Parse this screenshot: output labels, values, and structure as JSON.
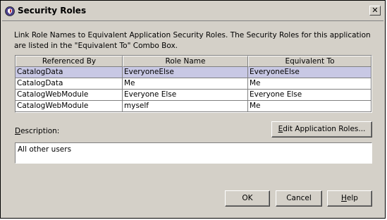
{
  "window": {
    "title": "Security Roles",
    "close_glyph": "✕"
  },
  "intro": {
    "line1": "Link Role Names to Equivalent Application Security Roles.  The Security Roles for this application",
    "line2": "are listed in the \"Equivalent To\" Combo Box."
  },
  "table": {
    "headers": [
      "Referenced By",
      "Role Name",
      "Equivalent To"
    ],
    "rows": [
      [
        "CatalogData",
        "EveryoneElse",
        "EveryoneElse"
      ],
      [
        "CatalogData",
        "Me",
        "Me"
      ],
      [
        "CatalogWebModule",
        "Everyone Else",
        "Everyone Else"
      ],
      [
        "CatalogWebModule",
        "myself",
        "Me"
      ]
    ],
    "selected_row": 0
  },
  "description": {
    "label_first": "D",
    "label_rest": "escription:",
    "value": "All other users"
  },
  "buttons": {
    "edit_first": "E",
    "edit_rest": "dit Application Roles...",
    "ok": "OK",
    "cancel": "Cancel",
    "help_first": "H",
    "help_rest": "elp"
  },
  "colors": {
    "dialog_bg": "#d4d0c8",
    "selection": "#c8c8e4"
  },
  "icons": {
    "app": "shield-icon",
    "close": "close-icon"
  }
}
